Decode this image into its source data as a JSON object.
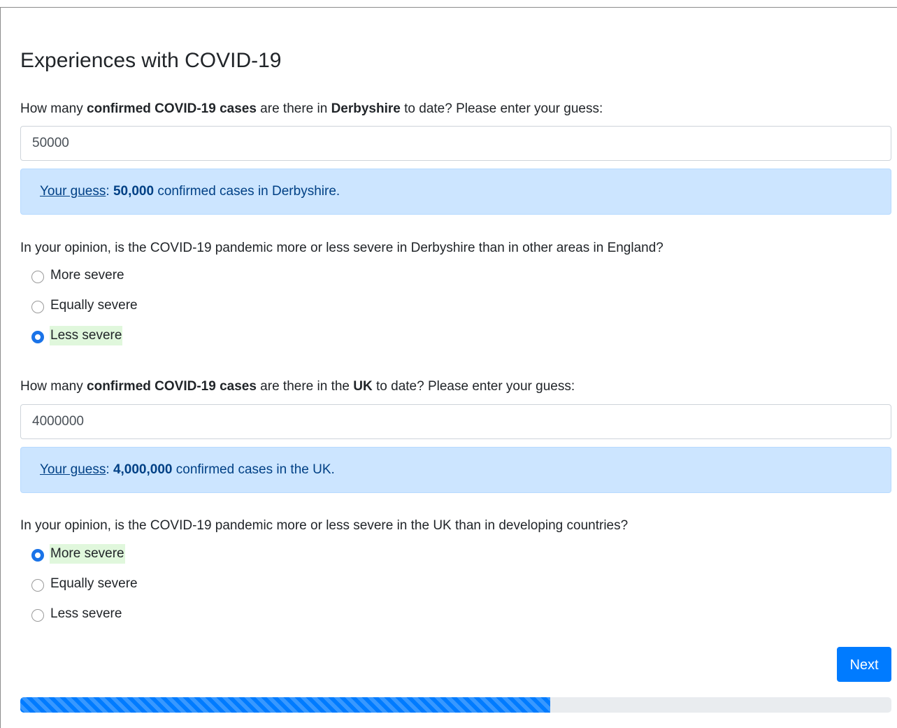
{
  "page": {
    "title": "Experiences with COVID-19"
  },
  "q1": {
    "text_a": "How many ",
    "text_b": "confirmed COVID-19 cases",
    "text_c": " are there in ",
    "text_d": "Derbyshire",
    "text_e": " to date? Please enter your guess:",
    "value": "50000",
    "feedback_label": "Your guess",
    "feedback_sep": ": ",
    "feedback_value": "50,000",
    "feedback_rest": " confirmed cases in Derbyshire."
  },
  "q2": {
    "text": "In your opinion, is the COVID-19 pandemic more or less severe in Derbyshire than in other areas in England?",
    "options": [
      "More severe",
      "Equally severe",
      "Less severe"
    ],
    "selected_index": 2
  },
  "q3": {
    "text_a": "How many ",
    "text_b": "confirmed COVID-19 cases",
    "text_c": " are there in the ",
    "text_d": "UK",
    "text_e": " to date? Please enter your guess:",
    "value": "4000000",
    "feedback_label": "Your guess",
    "feedback_sep": ": ",
    "feedback_value": "4,000,000",
    "feedback_rest": " confirmed cases in the UK."
  },
  "q4": {
    "text": "In your opinion, is the COVID-19 pandemic more or less severe in the UK than in developing countries?",
    "options": [
      "More severe",
      "Equally severe",
      "Less severe"
    ],
    "selected_index": 0
  },
  "next_label": "Next",
  "progress": {
    "fraction": 0.608
  },
  "colors": {
    "primary": "#007bff",
    "alert_bg": "#cce5ff",
    "alert_text": "#004085",
    "selected_bg": "#e0f7dc"
  }
}
